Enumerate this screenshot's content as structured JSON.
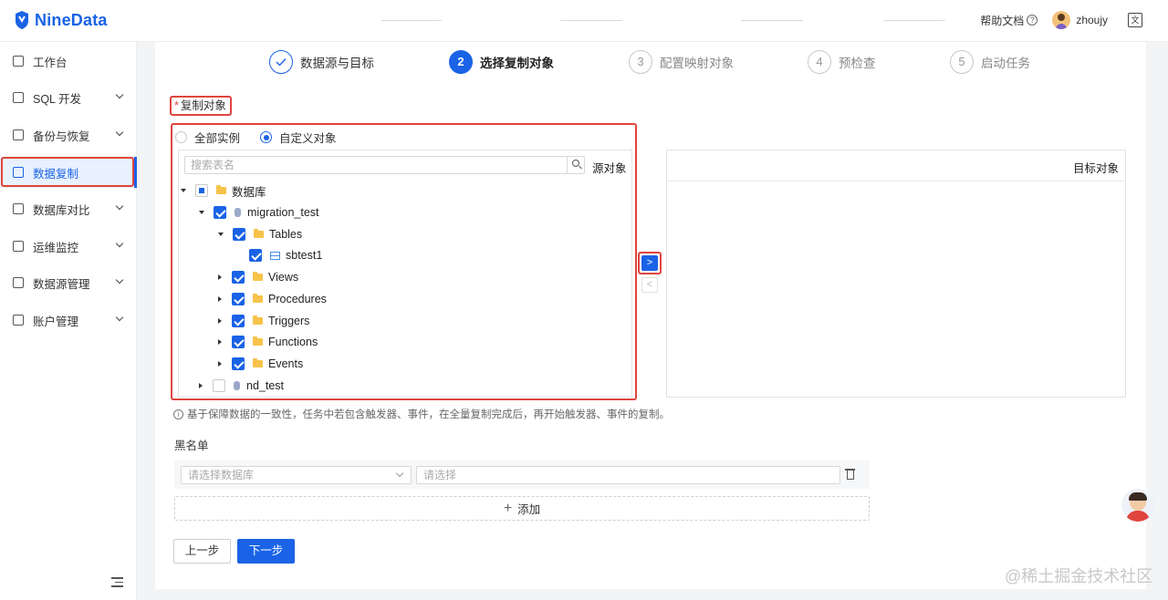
{
  "app": {
    "logo_text": "NineData",
    "brand_color": "#1a63e6"
  },
  "topbar": {
    "help_label": "帮助文档",
    "help_icon": "question-circle-icon",
    "user_name": "zhoujy",
    "lang_icon": "translate-icon"
  },
  "sidebar": {
    "items": [
      {
        "label": "工作台",
        "icon": "home-icon",
        "has_chevron": false
      },
      {
        "label": "SQL 开发",
        "icon": "monitor-icon",
        "has_chevron": true
      },
      {
        "label": "备份与恢复",
        "icon": "cloud-backup-icon",
        "has_chevron": true
      },
      {
        "label": "数据复制",
        "icon": "copy-icon",
        "has_chevron": false,
        "active": true
      },
      {
        "label": "数据库对比",
        "icon": "compare-icon",
        "has_chevron": true
      },
      {
        "label": "运维监控",
        "icon": "alarm-icon",
        "has_chevron": true
      },
      {
        "label": "数据源管理",
        "icon": "datasource-icon",
        "has_chevron": true
      },
      {
        "label": "账户管理",
        "icon": "account-icon",
        "has_chevron": true
      }
    ]
  },
  "steps": [
    {
      "num": "",
      "label": "数据源与目标",
      "state": "done"
    },
    {
      "num": "2",
      "label": "选择复制对象",
      "state": "current"
    },
    {
      "num": "3",
      "label": "配置映射对象",
      "state": "todo"
    },
    {
      "num": "4",
      "label": "预检查",
      "state": "todo"
    },
    {
      "num": "5",
      "label": "启动任务",
      "state": "todo"
    }
  ],
  "form": {
    "required_star": "*",
    "copy_object_label": "复制对象",
    "radio_all": "全部实例",
    "radio_custom": "自定义对象",
    "radio_selected": "custom",
    "search_placeholder": "搜索表名",
    "source_title": "源对象",
    "target_title": "目标对象",
    "move_right": ">",
    "move_left": "<"
  },
  "tree": [
    {
      "label": "数据库",
      "level": 0,
      "caret": "down",
      "check": "partial",
      "icon": "folder-icon"
    },
    {
      "label": "migration_test",
      "level": 1,
      "caret": "down",
      "check": "checked",
      "icon": "database-icon"
    },
    {
      "label": "Tables",
      "level": 2,
      "caret": "down",
      "check": "checked",
      "icon": "folder-icon"
    },
    {
      "label": "sbtest1",
      "level": 3,
      "caret": "none",
      "check": "checked",
      "icon": "table-icon"
    },
    {
      "label": "Views",
      "level": 2,
      "caret": "right",
      "check": "checked",
      "icon": "folder-icon"
    },
    {
      "label": "Procedures",
      "level": 2,
      "caret": "right",
      "check": "checked",
      "icon": "folder-icon"
    },
    {
      "label": "Triggers",
      "level": 2,
      "caret": "right",
      "check": "checked",
      "icon": "folder-icon"
    },
    {
      "label": "Functions",
      "level": 2,
      "caret": "right",
      "check": "checked",
      "icon": "folder-icon"
    },
    {
      "label": "Events",
      "level": 2,
      "caret": "right",
      "check": "checked",
      "icon": "folder-icon"
    },
    {
      "label": "nd_test",
      "level": 1,
      "caret": "right",
      "check": "unchecked",
      "icon": "database-icon"
    }
  ],
  "hint": "基于保障数据的一致性，任务中若包含触发器、事件，在全量复制完成后，再开始触发器、事件的复制。",
  "blacklist": {
    "label": "黑名单",
    "db_placeholder": "请选择数据库",
    "obj_placeholder": "请选择",
    "add_label": "添加"
  },
  "buttons": {
    "prev": "上一步",
    "next": "下一步"
  },
  "watermark": "@稀土掘金技术社区"
}
